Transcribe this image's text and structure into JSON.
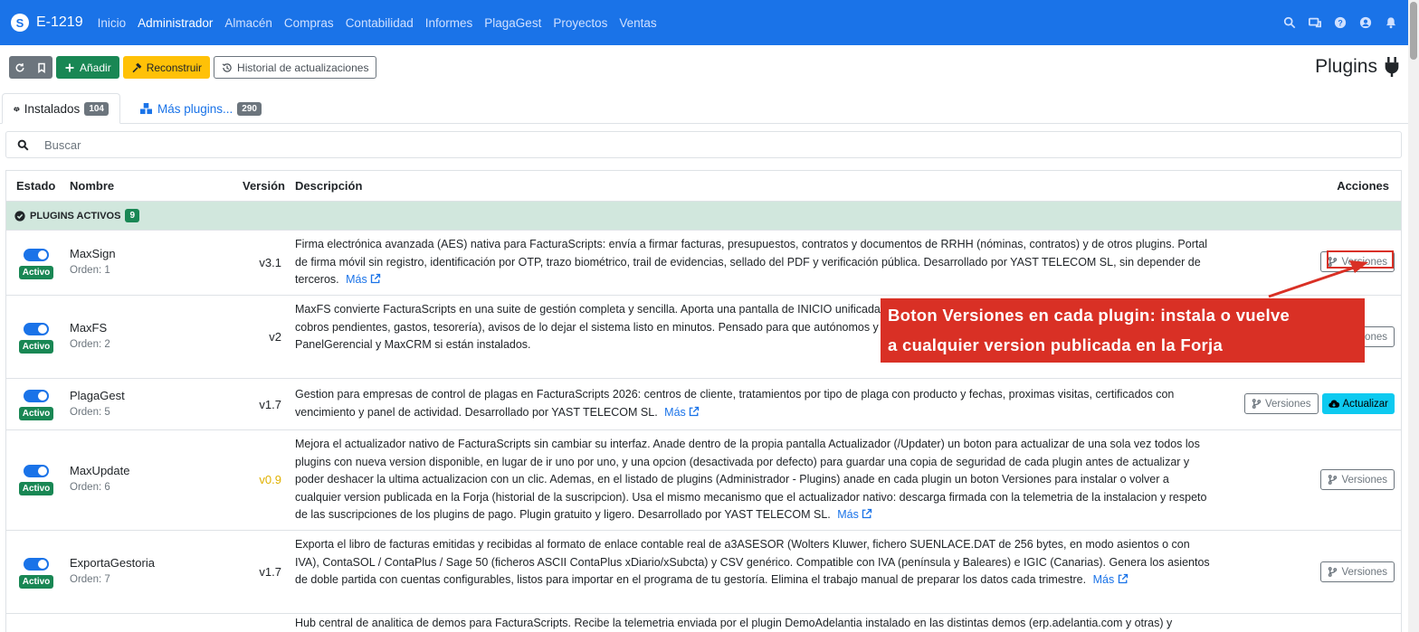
{
  "navbar": {
    "brand": "E-1219",
    "logo_letter": "S",
    "items": [
      "Inicio",
      "Administrador",
      "Almacén",
      "Compras",
      "Contabilidad",
      "Informes",
      "PlagaGest",
      "Proyectos",
      "Ventas"
    ],
    "active_item": "Administrador",
    "icons": [
      "search-icon",
      "screen-chat-icon",
      "help-icon",
      "user-icon",
      "bell-icon"
    ],
    "background": "#1a73e8"
  },
  "toolbar": {
    "add_label": "Añadir",
    "rebuild_label": "Reconstruir",
    "history_label": "Historial de actualizaciones"
  },
  "page": {
    "title": "Plugins"
  },
  "tabs": {
    "installed_label": "Instalados",
    "installed_count": "104",
    "more_label": "Más plugins...",
    "more_count": "290"
  },
  "search": {
    "placeholder": "Buscar"
  },
  "table": {
    "headers": {
      "status": "Estado",
      "name": "Nombre",
      "version": "Versión",
      "description": "Descripción",
      "actions": "Acciones"
    },
    "group": {
      "label": "PLUGINS ACTIVOS",
      "count": "9"
    },
    "status_label": "Activo",
    "versions_label": "Versiones",
    "update_label": "Actualizar",
    "more_label": "Más",
    "rows": [
      {
        "name": "MaxSign",
        "order": "Orden: 1",
        "version": "v3.1",
        "description": "Firma electrónica avanzada (AES) nativa para FacturaScripts: envía a firmar facturas, presupuestos, contratos y documentos de RRHH (nóminas, contratos) y de otros plugins. Portal de firma móvil sin registro, identificación por OTP, trazo biométrico, trail de evidencias, sellado del PDF y verificación pública. Desarrollado por YAST TELECOM SL, sin depender de terceros."
      },
      {
        "name": "MaxFS",
        "order": "Orden: 2",
        "version": "v2",
        "description": "MaxFS convierte FacturaScripts en una suite de gestión completa y sencilla. Aporta una pantalla de INICIO unificada Holded): saludo, acciones rápidas, KPIs en tiempo real (ventas, cobros pendientes, gastos, tesorería), avisos de lo dejar el sistema listo en minutos. Pensado para que autónomos y pymes usen FacturaScripts sin complicaciones. AsistenteIAFS, PanelGerencial y MaxCRM si están instalados."
      },
      {
        "name": "PlagaGest",
        "order": "Orden: 5",
        "version": "v1.7",
        "description": "Gestion para empresas de control de plagas en FacturaScripts 2026: centros de cliente, tratamientos por tipo de plaga con producto y fechas, proximas visitas, certificados con vencimiento y panel de actividad. Desarrollado por YAST TELECOM SL."
      },
      {
        "name": "MaxUpdate",
        "order": "Orden: 6",
        "version": "v0.9",
        "description": "Mejora el actualizador nativo de FacturaScripts sin cambiar su interfaz. Anade dentro de la propia pantalla Actualizador (/Updater) un boton para actualizar de una sola vez todos los plugins con nueva version disponible, en lugar de ir uno por uno, y una opcion (desactivada por defecto) para guardar una copia de seguridad de cada plugin antes de actualizar y poder deshacer la ultima actualizacion con un clic. Ademas, en el listado de plugins (Administrador - Plugins) anade en cada plugin un boton Versiones para instalar o volver a cualquier version publicada en la Forja (historial de la suscripcion). Usa el mismo mecanismo que el actualizador nativo: descarga firmada con la telemetria de la instalacion y respeto de las suscripciones de los plugins de pago. Plugin gratuito y ligero. Desarrollado por YAST TELECOM SL."
      },
      {
        "name": "ExportaGestoria",
        "order": "Orden: 7",
        "version": "v1.7",
        "description": "Exporta el libro de facturas emitidas y recibidas al formato de enlace contable real de a3ASESOR (Wolters Kluwer, fichero SUENLACE.DAT de 256 bytes, en modo asientos o con IVA), ContaSOL / ContaPlus / Sage 50 (ficheros ASCII ContaPlus xDiario/xSubcta) y CSV genérico. Compatible con IVA (península y Baleares) e IGIC (Canarias). Genera los asientos de doble partida con cuentas configurables, listos para importar en el programa de tu gestoría. Elimina el trabajo manual de preparar los datos cada trimestre."
      },
      {
        "description": "Hub central de analitica de demos para FacturaScripts. Recibe la telemetria enviada por el plugin DemoAdelantia instalado en las distintas demos (erp.adelantia.com y otras) y"
      }
    ]
  },
  "annotation": {
    "line1": "Boton Versiones en cada plugin: instala o vuelve",
    "line2": "a cualquier version publicada en la Forja",
    "color": "#d93025"
  }
}
